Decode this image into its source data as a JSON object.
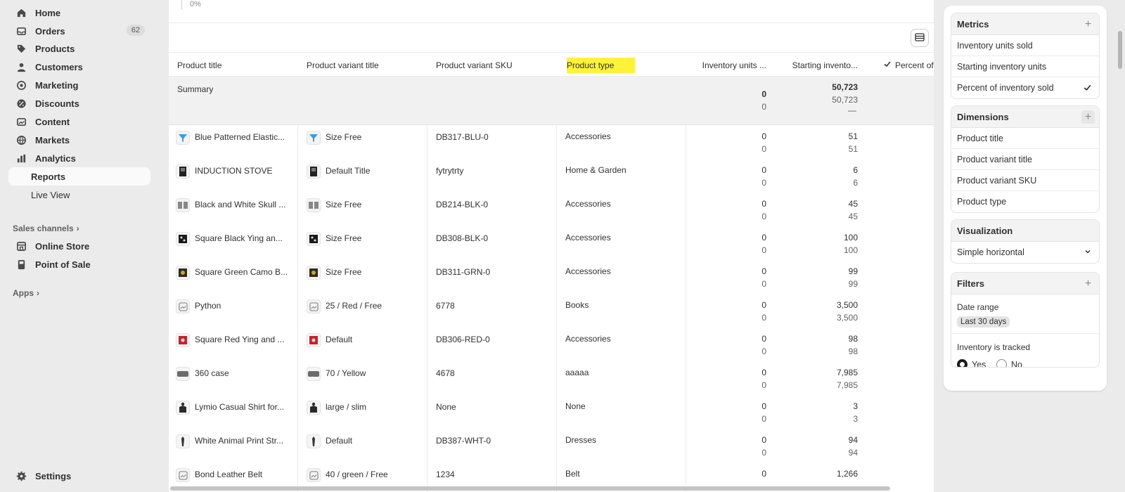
{
  "sidebar": {
    "items": [
      {
        "label": "Home",
        "icon": "home-icon"
      },
      {
        "label": "Orders",
        "icon": "orders-icon",
        "badge": "62"
      },
      {
        "label": "Products",
        "icon": "tag-icon"
      },
      {
        "label": "Customers",
        "icon": "person-icon"
      },
      {
        "label": "Marketing",
        "icon": "target-icon"
      },
      {
        "label": "Discounts",
        "icon": "discount-icon"
      },
      {
        "label": "Content",
        "icon": "image-icon"
      },
      {
        "label": "Markets",
        "icon": "globe-icon"
      },
      {
        "label": "Analytics",
        "icon": "bar-chart-icon"
      }
    ],
    "reports_label": "Reports",
    "live_view_label": "Live View",
    "sales_channels_label": "Sales channels",
    "online_store_label": "Online Store",
    "pos_label": "Point of Sale",
    "apps_label": "Apps",
    "settings_label": "Settings"
  },
  "chart": {
    "zero_label": "0%"
  },
  "table": {
    "columns": [
      "Product title",
      "Product variant title",
      "Product variant SKU",
      "Product type",
      "Inventory units ...",
      "Starting invento...",
      "Percent of"
    ],
    "summary": {
      "label": "Summary",
      "units_sold": "0",
      "units_sold_2": "0",
      "starting": "50,723",
      "starting_2": "50,723",
      "percent": "—"
    },
    "rows": [
      {
        "title": "Blue Patterned Elastic...",
        "variant": "Size Free",
        "sku": "DB317-BLU-0",
        "type": "Accessories",
        "sold": "0",
        "sold2": "0",
        "start": "51",
        "start2": "51",
        "thumb": "blue"
      },
      {
        "title": "INDUCTION STOVE",
        "variant": "Default Title",
        "sku": "fytrytrty",
        "type": "Home & Garden",
        "sold": "0",
        "sold2": "0",
        "start": "6",
        "start2": "6",
        "thumb": "dark"
      },
      {
        "title": "Black and White Skull ...",
        "variant": "Size Free",
        "sku": "DB214-BLK-0",
        "type": "Accessories",
        "sold": "0",
        "sold2": "0",
        "start": "45",
        "start2": "45",
        "thumb": "gray"
      },
      {
        "title": "Square Black Ying an...",
        "variant": "Size Free",
        "sku": "DB308-BLK-0",
        "type": "Accessories",
        "sold": "0",
        "sold2": "0",
        "start": "100",
        "start2": "100",
        "thumb": "black"
      },
      {
        "title": "Square Green Camo B...",
        "variant": "Size Free",
        "sku": "DB311-GRN-0",
        "type": "Accessories",
        "sold": "0",
        "sold2": "0",
        "start": "99",
        "start2": "99",
        "thumb": "camo"
      },
      {
        "title": "Python",
        "variant": "25 / Red / Free",
        "sku": "6778",
        "type": "Books",
        "sold": "0",
        "sold2": "0",
        "start": "3,500",
        "start2": "3,500",
        "thumb": "placeholder"
      },
      {
        "title": "Square Red Ying and ...",
        "variant": "Default",
        "sku": "DB306-RED-0",
        "type": "Accessories",
        "sold": "0",
        "sold2": "0",
        "start": "98",
        "start2": "98",
        "thumb": "red"
      },
      {
        "title": "360 case",
        "variant": "70 / Yellow",
        "sku": "4678",
        "type": "aaaaa",
        "sold": "0",
        "sold2": "0",
        "start": "7,985",
        "start2": "7,985",
        "thumb": "case"
      },
      {
        "title": "Lymio Casual Shirt for...",
        "variant": "large / slim",
        "sku": "None",
        "type": "None",
        "sold": "0",
        "sold2": "0",
        "start": "3",
        "start2": "3",
        "thumb": "shirt"
      },
      {
        "title": "White Animal Print Str...",
        "variant": "Default",
        "sku": "DB387-WHT-0",
        "type": "Dresses",
        "sold": "0",
        "sold2": "0",
        "start": "94",
        "start2": "94",
        "thumb": "tie"
      },
      {
        "title": "Bond Leather Belt",
        "variant": "40 / green / Free",
        "sku": "1234",
        "type": "Belt",
        "sold": "0",
        "sold2": "",
        "start": "1,266",
        "start2": "",
        "thumb": "placeholder"
      }
    ]
  },
  "panel": {
    "metrics": {
      "title": "Metrics",
      "items": [
        "Inventory units sold",
        "Starting inventory units",
        "Percent of inventory sold"
      ]
    },
    "dimensions": {
      "title": "Dimensions",
      "items": [
        "Product title",
        "Product variant title",
        "Product variant SKU",
        "Product type"
      ]
    },
    "visualization": {
      "title": "Visualization",
      "value": "Simple horizontal"
    },
    "filters": {
      "title": "Filters",
      "date_range_label": "Date range",
      "date_range_value": "Last 30 days",
      "tracked_label": "Inventory is tracked",
      "yes_label": "Yes",
      "no_label": "No",
      "selected": "Yes"
    }
  },
  "colors": {
    "highlight": "#fff23a",
    "sidebar_bg": "#ebebeb",
    "summary_bg": "#f1f1f1"
  }
}
